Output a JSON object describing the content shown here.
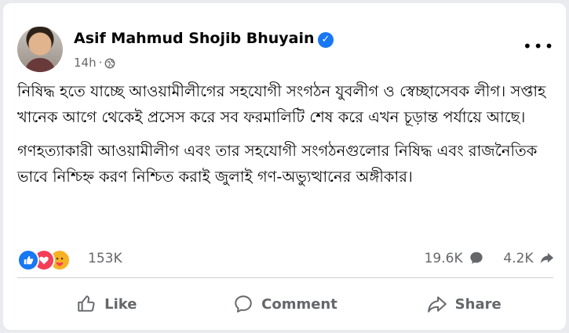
{
  "post": {
    "author": "Asif Mahmud Shojib Bhuyain",
    "verified_icon": "check-badge",
    "time": "14h",
    "audience_icon": "globe-icon",
    "more_label": "•••",
    "paragraphs": [
      "নিষিদ্ধ হতে যাচ্ছে আওয়ামীলীগের সহযোগী সংগঠন যুবলীগ ও স্বেচ্ছাসেবক লীগ। সপ্তাহ খানেক আগে থেকেই প্রসেস করে সব ফরমালিটি শেষ করে এখন চূড়ান্ত পর্যায়ে আছে।",
      "গণহত্যাকারী আওয়ামীলীগ এবং তার সহযোগী সংগঠনগুলোর নিষিদ্ধ এবং রাজনৈতিক ভাবে নিশ্চিহ্ন করণ নিশ্চিত করাই জুলাই গণ-অভ্যুত্থানের অঙ্গীকার।"
    ]
  },
  "stats": {
    "reactions": "153K",
    "comments": "19.6K",
    "shares": "4.2K",
    "reaction_icons": [
      "like-icon",
      "love-icon",
      "care-icon"
    ]
  },
  "actions": {
    "like": "Like",
    "comment": "Comment",
    "share": "Share"
  },
  "colors": {
    "accent": "#1877f2",
    "secondary_text": "#65676b",
    "primary_text": "#050505"
  }
}
